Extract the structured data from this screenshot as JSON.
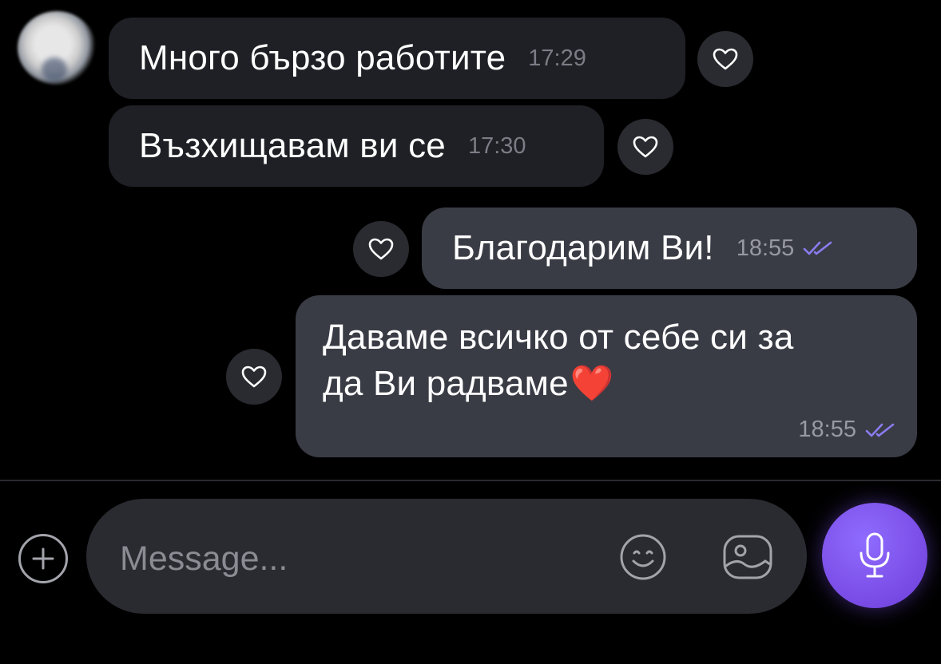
{
  "messages": [
    {
      "direction": "incoming",
      "text": "Много бързо работите",
      "time": "17:29"
    },
    {
      "direction": "incoming",
      "text": "Възхищавам ви се",
      "time": "17:30"
    },
    {
      "direction": "outgoing",
      "text": "Благодарим Ви!",
      "time": "18:55",
      "status": "read"
    },
    {
      "direction": "outgoing",
      "text_line1": "Даваме всичко от себе си за",
      "text_line2": "да Ви радваме",
      "emoji": "❤️",
      "time": "18:55",
      "status": "read"
    }
  ],
  "composer": {
    "placeholder": "Message...",
    "value": ""
  },
  "icons": {
    "like": "heart-icon",
    "add": "plus-icon",
    "emoji": "smiley-icon",
    "gallery": "image-icon",
    "voice": "microphone-icon",
    "read_receipt": "double-check-icon"
  },
  "colors": {
    "background": "#000000",
    "incoming_bubble": "#1f2025",
    "outgoing_bubble": "#3a3c45",
    "accent": "#7c4fe8",
    "read_check": "#8a7cf0"
  }
}
